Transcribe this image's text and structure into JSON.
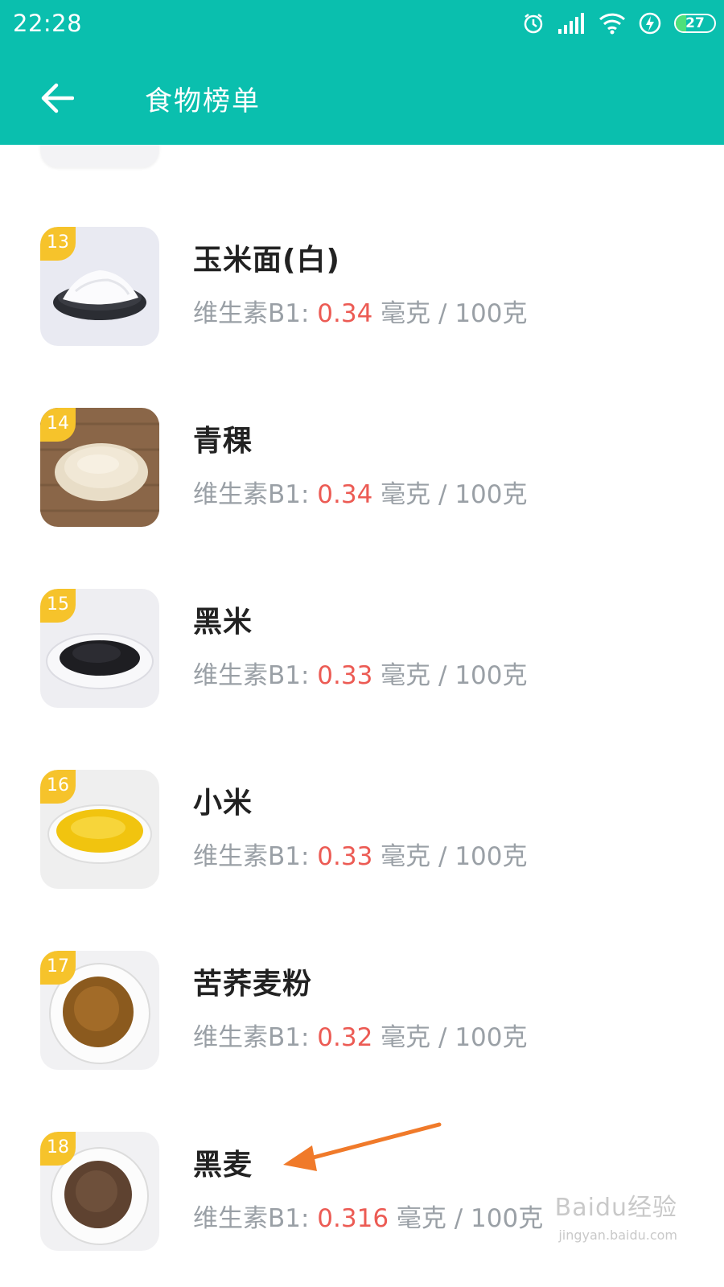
{
  "status_bar": {
    "time": "22:28",
    "battery": "27",
    "icons": [
      "alarm-icon",
      "signal-icon",
      "wifi-icon",
      "charging-icon",
      "battery-icon"
    ]
  },
  "header": {
    "title": "食物榜单",
    "back_icon": "back-arrow-icon",
    "color": "#0abfae"
  },
  "colors": {
    "value": "#ec5b54",
    "rank_badge": "#f6c32b",
    "secondary_text": "#9aa0a6"
  },
  "items": [
    {
      "rank": "13",
      "name": "玉米面(白)",
      "nutrient": "维生素B1: ",
      "value": "0.34",
      "unit": " 毫克 / 100克"
    },
    {
      "rank": "14",
      "name": "青稞",
      "nutrient": "维生素B1: ",
      "value": "0.34",
      "unit": " 毫克 / 100克"
    },
    {
      "rank": "15",
      "name": "黑米",
      "nutrient": "维生素B1: ",
      "value": "0.33",
      "unit": " 毫克 / 100克"
    },
    {
      "rank": "16",
      "name": "小米",
      "nutrient": "维生素B1: ",
      "value": "0.33",
      "unit": " 毫克 / 100克"
    },
    {
      "rank": "17",
      "name": "苦荞麦粉",
      "nutrient": "维生素B1: ",
      "value": "0.32",
      "unit": " 毫克 / 100克"
    },
    {
      "rank": "18",
      "name": "黑麦",
      "nutrient": "维生素B1: ",
      "value": "0.316",
      "unit": " 毫克 / 100克"
    }
  ],
  "watermark": {
    "text": "Baidu经验",
    "sub": "jingyan.baidu.com"
  }
}
